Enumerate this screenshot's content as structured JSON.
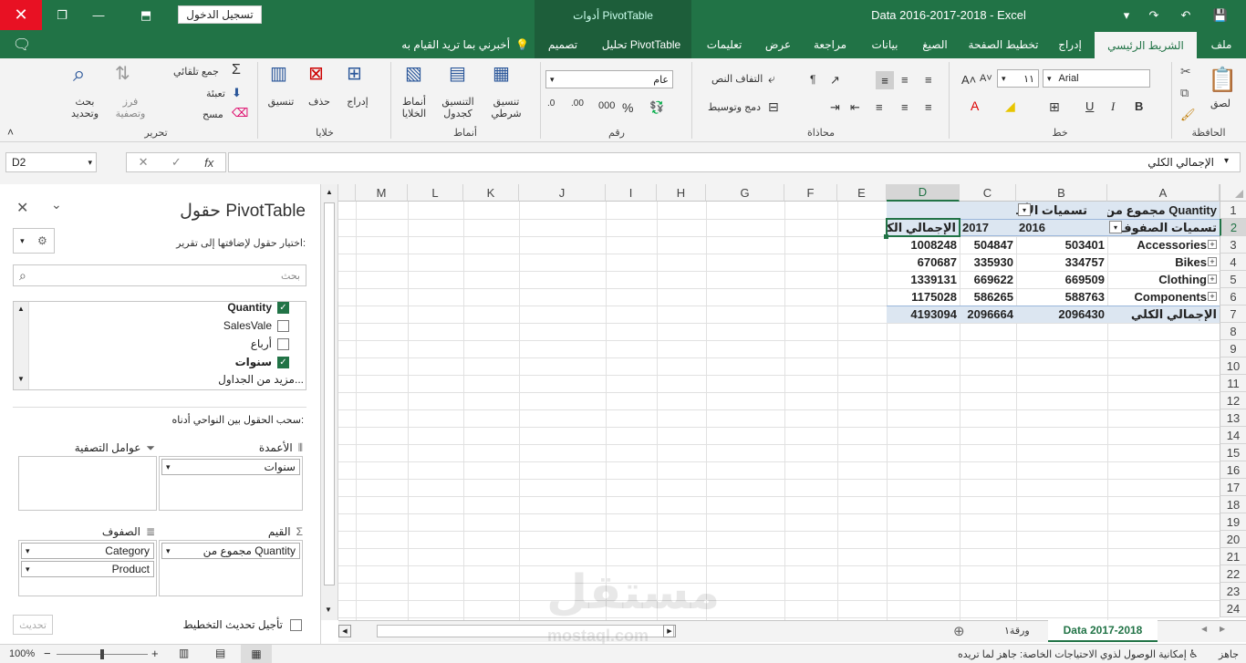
{
  "titlebar": {
    "signin": "تسجيل الدخول",
    "pivot_tools": "أدوات PivotTable",
    "title": "Data 2016-2017-2018  -  Excel"
  },
  "tabs": [
    "ملف",
    "الشريط الرئيسي",
    "إدراج",
    "تخطيط الصفحة",
    "الصيغ",
    "بيانات",
    "مراجعة",
    "عرض",
    "تعليمات",
    "تحليل PivotTable",
    "تصميم"
  ],
  "tellme": "أخبرني بما تريد القيام به",
  "ribbon": {
    "clipboard": {
      "label": "الحافظة",
      "paste": "لصق"
    },
    "font": {
      "label": "خط",
      "name": "Arial",
      "size": "١١"
    },
    "alignment": {
      "label": "محاذاة",
      "wrap": "التفاف النص",
      "merge": "دمج وتوسيط"
    },
    "number": {
      "label": "رقم",
      "format": "عام"
    },
    "styles": {
      "label": "أنماط",
      "cond": "تنسيق شرطي",
      "table": "التنسيق كجدول",
      "cell": "أنماط الخلايا"
    },
    "cells": {
      "label": "خلايا",
      "insert": "إدراج",
      "delete": "حذف",
      "format": "تنسيق"
    },
    "editing": {
      "label": "تحرير",
      "autosum": "جمع تلقائي",
      "fill": "تعبئة",
      "clear": "مسح",
      "sort": "فرز وتصفية",
      "find": "بحث وتحديد"
    }
  },
  "formula_bar": {
    "namebox": "D2",
    "formula": "الإجمالي الكلي",
    "fx": "fx"
  },
  "panel": {
    "title": "حقول PivotTable",
    "subtitle": "اختيار حقول لإضافتها إلى تقرير:",
    "search_placeholder": "بحث",
    "fields": [
      {
        "name": "Quantity",
        "checked": true,
        "bold": true
      },
      {
        "name": "SalesVale",
        "checked": false,
        "bold": false
      },
      {
        "name": "أرباع",
        "checked": false,
        "bold": false
      },
      {
        "name": "سنوات",
        "checked": true,
        "bold": true
      }
    ],
    "more_tables": "مزيد من الجداول...",
    "drag_hint": "سحب الحقول بين النواحي أدناه:",
    "filters_label": "عوامل التصفية",
    "columns_label": "الأعمدة",
    "columns_items": [
      "سنوات"
    ],
    "rows_label": "الصفوف",
    "rows_items": [
      "Category",
      "Product"
    ],
    "values_label": "القيم",
    "values_items": [
      "مجموع من Quantity"
    ],
    "defer": "تأجيل تحديث التخطيط",
    "update": "تحديث"
  },
  "grid": {
    "columns": [
      "A",
      "B",
      "C",
      "D",
      "E",
      "F",
      "G",
      "H",
      "I",
      "J",
      "K",
      "L",
      "M"
    ],
    "rows": [
      "1",
      "2",
      "3",
      "4",
      "5",
      "6",
      "7",
      "8",
      "9",
      "10",
      "11",
      "12",
      "13",
      "14",
      "15",
      "16",
      "17",
      "18",
      "19",
      "20",
      "21",
      "22",
      "23",
      "24"
    ],
    "pivot": {
      "a1": "مجموع من Quantity",
      "b1": "تسميات الأعمدة",
      "a2": "تسميات الصفوف",
      "b2": "2016",
      "c2": "2017",
      "d2": "الإجمالي الكلي",
      "body": [
        {
          "label": "Accessories",
          "b": "503401",
          "c": "504847",
          "d": "1008248"
        },
        {
          "label": "Bikes",
          "b": "334757",
          "c": "335930",
          "d": "670687"
        },
        {
          "label": "Clothing",
          "b": "669509",
          "c": "669622",
          "d": "1339131"
        },
        {
          "label": "Components",
          "b": "588763",
          "c": "586265",
          "d": "1175028"
        }
      ],
      "total": {
        "label": "الإجمالي الكلي",
        "b": "2096430",
        "c": "2096664",
        "d": "4193094"
      }
    }
  },
  "sheets": {
    "active": "Data 2017-2018",
    "other": "ورقة١"
  },
  "status": {
    "ready": "جاهز",
    "accessibility": "إمكانية الوصول لذوي الاحتياجات الخاصة: جاهز لما تريده",
    "zoom": "100%"
  },
  "watermark": {
    "ar": "مستقل",
    "en": "mostaql.com"
  },
  "colors": {
    "excel_green": "#217346",
    "header_blue": "#dce6f1",
    "close_red": "#e81123"
  }
}
